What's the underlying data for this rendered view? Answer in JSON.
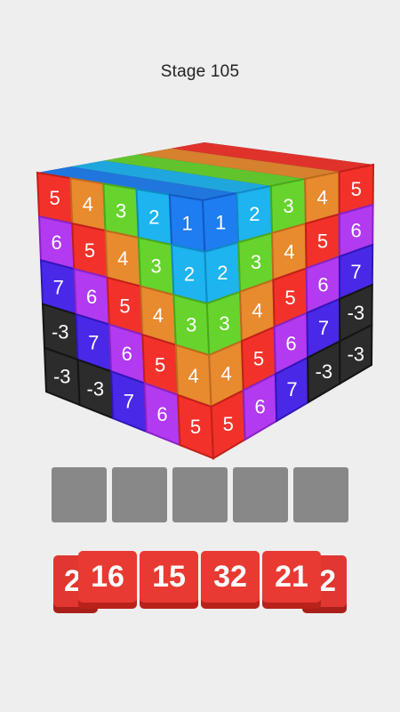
{
  "stage_label": "Stage 105",
  "colors": {
    "5": [
      "#f2322a",
      "#c21f19"
    ],
    "4": [
      "#e88a2e",
      "#bf6a1c"
    ],
    "3": [
      "#66d42c",
      "#49a81c"
    ],
    "2": [
      "#1db4f0",
      "#0f8cc4"
    ],
    "1": [
      "#1e7df0",
      "#1159c4"
    ],
    "6": [
      "#b23af0",
      "#8a22c4"
    ],
    "7": [
      "#4a28e8",
      "#3216b8"
    ],
    "-3": [
      "#2c2c2c",
      "#141414"
    ]
  },
  "cube": {
    "left_face": [
      [
        "5",
        "4",
        "3",
        "2",
        "1"
      ],
      [
        "6",
        "5",
        "4",
        "3",
        "2"
      ],
      [
        "7",
        "6",
        "5",
        "4",
        "3"
      ],
      [
        "-3",
        "7",
        "6",
        "5",
        "4"
      ],
      [
        "-3",
        "-3",
        "7",
        "6",
        "5"
      ]
    ],
    "right_face": [
      [
        "1",
        "2",
        "3",
        "4",
        "5"
      ],
      [
        "2",
        "3",
        "4",
        "5",
        "6"
      ],
      [
        "3",
        "4",
        "5",
        "6",
        "7"
      ],
      [
        "4",
        "5",
        "6",
        "7",
        "-3"
      ],
      [
        "5",
        "6",
        "7",
        "-3",
        "-3"
      ]
    ]
  },
  "slots": [
    {
      "id": 1
    },
    {
      "id": 2
    },
    {
      "id": 3
    },
    {
      "id": 4
    },
    {
      "id": 5
    }
  ],
  "queue": {
    "front": [
      "16",
      "15",
      "32",
      "21"
    ],
    "back_left_partial": "2",
    "back_right_partial": "2"
  }
}
